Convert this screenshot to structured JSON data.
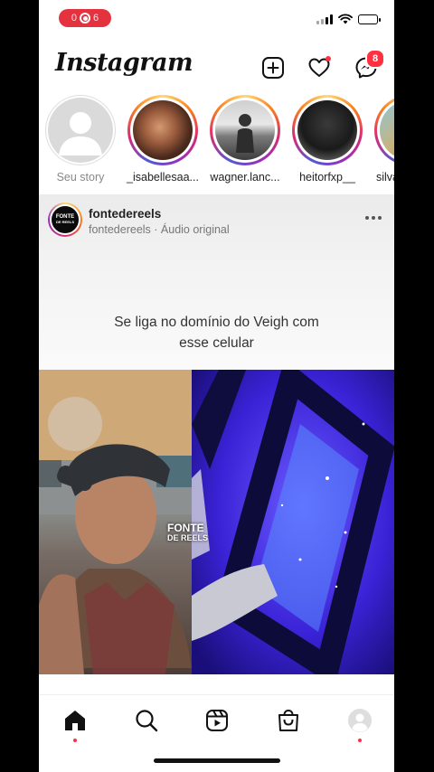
{
  "status_bar": {
    "recording_digits": "06",
    "battery_level": 0.55,
    "signal_bars_active": 3
  },
  "header": {
    "logo_text": "Instagram",
    "messages_badge": "8"
  },
  "stories": [
    {
      "label": "Seu story",
      "own": true
    },
    {
      "label": "_isabellesaa..."
    },
    {
      "label": "wagner.lanc..."
    },
    {
      "label": "heitorfxp__"
    },
    {
      "label": "silva"
    }
  ],
  "post": {
    "username": "fontedereels",
    "subtitle": "fontedereels · Áudio original",
    "avatar_text_line1": "FONTE",
    "avatar_text_line2": "DE REELS",
    "caption_line1": "Se liga no domínio do Veigh com",
    "caption_line2": "esse celular",
    "watermark_line1": "FONTE",
    "watermark_line2": "DE REELS"
  },
  "nav": {
    "items": [
      "home",
      "search",
      "reels",
      "shop",
      "profile"
    ]
  },
  "colors": {
    "notification_red": "#ff3040",
    "recording_red": "#e5323f",
    "story_gradient": [
      "#feda75",
      "#fa7e1e",
      "#d62976",
      "#962fbf",
      "#4f5bd5"
    ]
  }
}
